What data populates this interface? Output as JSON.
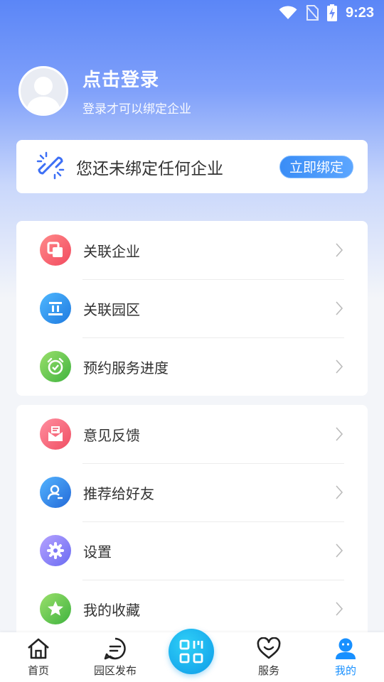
{
  "status_bar": {
    "time": "9:23"
  },
  "profile": {
    "title": "点击登录",
    "subtitle": "登录才可以绑定企业"
  },
  "bind_card": {
    "text": "您还未绑定任何企业",
    "button": "立即绑定"
  },
  "menu_group_1": [
    {
      "label": "关联企业",
      "icon": "company-icon"
    },
    {
      "label": "关联园区",
      "icon": "park-icon"
    },
    {
      "label": "预约服务进度",
      "icon": "alarm-clock-icon"
    }
  ],
  "menu_group_2": [
    {
      "label": "意见反馈",
      "icon": "feedback-mail-icon"
    },
    {
      "label": "推荐给好友",
      "icon": "recommend-user-icon"
    },
    {
      "label": "设置",
      "icon": "gear-icon"
    },
    {
      "label": "我的收藏",
      "icon": "star-icon"
    }
  ],
  "tabbar": {
    "home": "首页",
    "park_post": "园区发布",
    "service": "服务",
    "mine": "我的"
  },
  "colors": {
    "accent": "#1890ff",
    "hero_top": "#5b86f7",
    "bind_button": "#3a8df6"
  }
}
